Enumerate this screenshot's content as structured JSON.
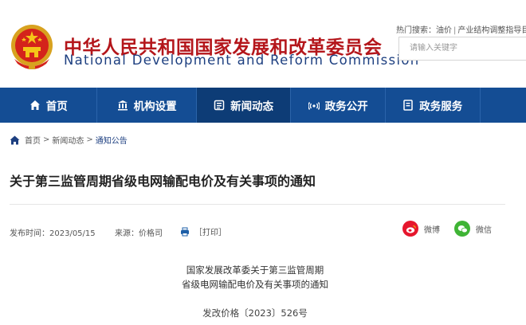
{
  "header": {
    "title_cn": "中华人民共和国国家发展和改革委员会",
    "title_en": "National Development and Reform Commission",
    "hot_search_label": "热门搜索：",
    "hot_search_items": [
      "油价",
      "产业结构调整指导目"
    ],
    "search_placeholder": "请输入关键字",
    "colors": {
      "brand_red": "#b4161b",
      "brand_blue": "#1d3f80"
    }
  },
  "nav": {
    "items": [
      {
        "label": "首页",
        "icon": "home-icon"
      },
      {
        "label": "机构设置",
        "icon": "institution-icon"
      },
      {
        "label": "新闻动态",
        "icon": "news-icon",
        "active": true
      },
      {
        "label": "政务公开",
        "icon": "broadcast-icon"
      },
      {
        "label": "政务服务",
        "icon": "document-icon"
      },
      {
        "label": "",
        "icon": ""
      }
    ],
    "colors": {
      "bar": "#144d94",
      "active": "#0d3c76"
    }
  },
  "breadcrumb": {
    "items": [
      "首页",
      "新闻动态",
      "通知公告"
    ],
    "separator": ">"
  },
  "article": {
    "title": "关于第三监管周期省级电网输配电价及有关事项的通知",
    "publish_time": "发布时间：2023/05/15",
    "source": "来源：价格司",
    "print_label": "［打印］",
    "share": {
      "weibo_label": "微博",
      "wechat_label": "微信"
    },
    "heading_line1": "国家发展改革委关于第三监管周期",
    "heading_line2": "省级电网输配电价及有关事项的通知",
    "doc_number": "发改价格〔2023〕526号"
  }
}
